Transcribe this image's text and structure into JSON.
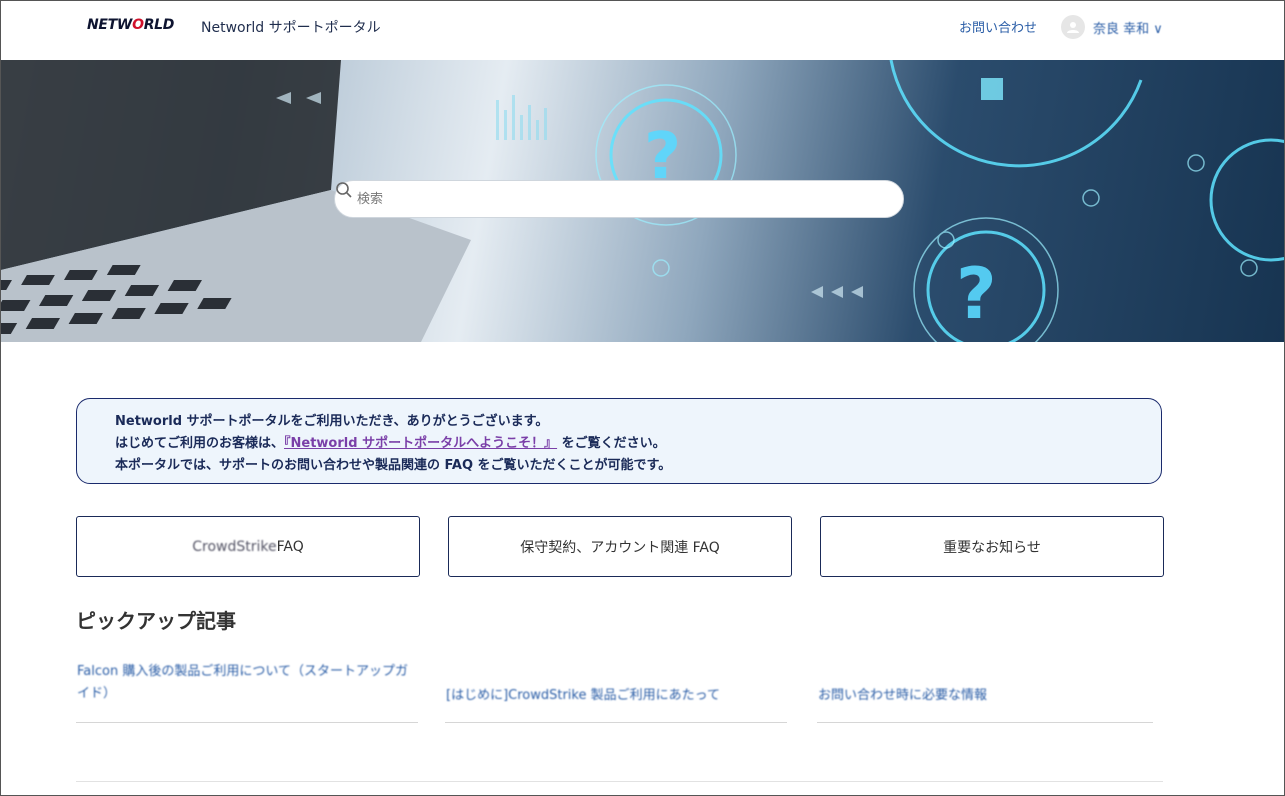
{
  "header": {
    "logo_text": "NETWORLD",
    "portal_title": "Networld サポートポータル",
    "contact_label": "お問い合わせ",
    "user_name": "奈良 幸和 ∨"
  },
  "search": {
    "placeholder": "検索"
  },
  "notice": {
    "line1": "Networld サポートポータルをご利用いただき、ありがとうございます。",
    "line2_prefix": "はじめてご利用のお客様は、",
    "line2_link": "『Networld サポートポータルへようこそ！』",
    "line2_suffix": " をご覧ください。",
    "line3": "本ポータルでは、サポートのお問い合わせや製品関連の FAQ をご覧いただくことが可能です。"
  },
  "categories": [
    {
      "label_prefix": "CrowdStrike",
      "label_suffix": " FAQ"
    },
    {
      "label": "保守契約、アカウント関連 FAQ"
    },
    {
      "label": "重要なお知らせ"
    }
  ],
  "pickup": {
    "title": "ピックアップ記事",
    "articles": [
      {
        "label": "Falcon 購入後の製品ご利用について（スタートアップガイド）"
      },
      {
        "label": "[はじめに]CrowdStrike 製品ご利用にあたって"
      },
      {
        "label": "お問い合わせ時に必要な情報"
      }
    ]
  },
  "colors": {
    "accent": "#2b5ea7",
    "notice_border": "#1a2a6c",
    "link_purple": "#7a3fa8",
    "logo_red": "#d0112b"
  }
}
